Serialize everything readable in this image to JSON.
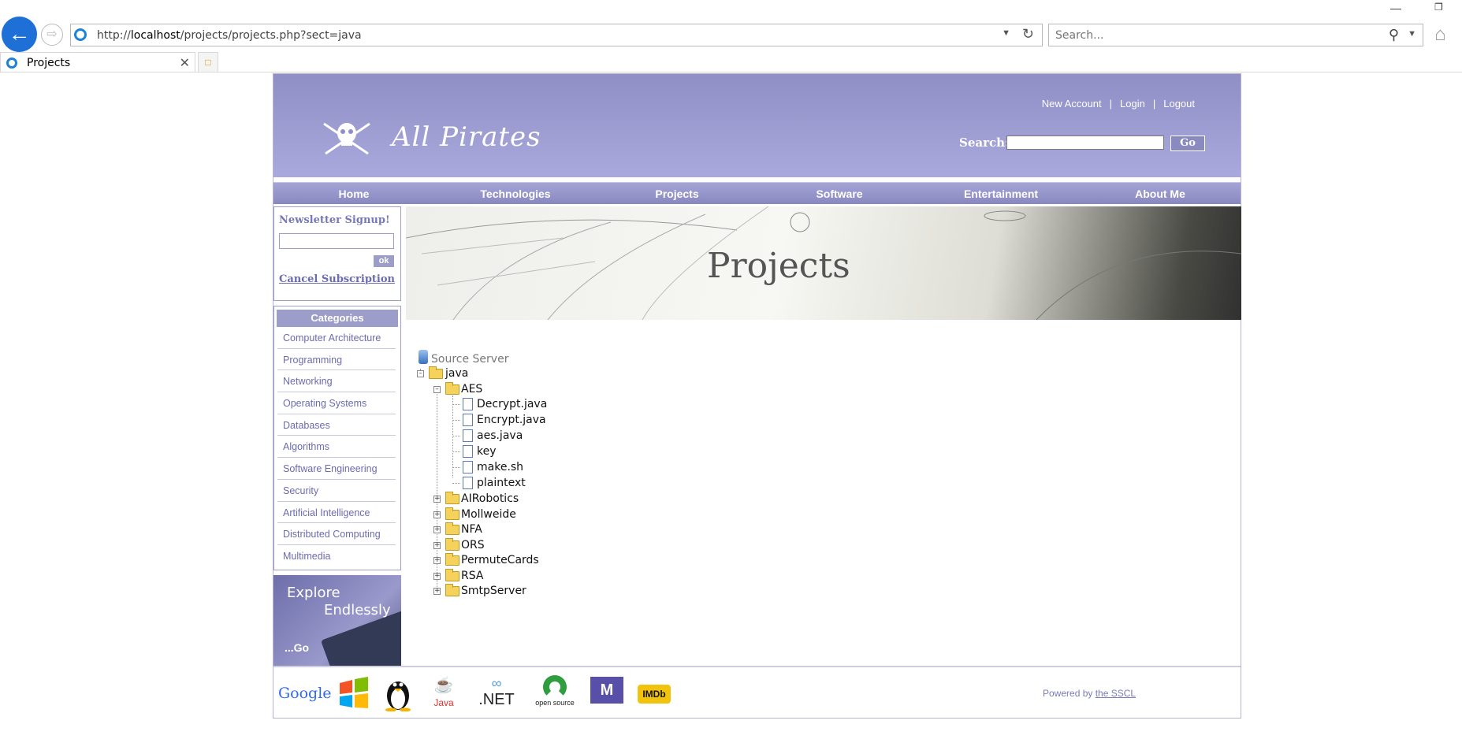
{
  "browser": {
    "url_prefix": "http://",
    "url_host": "localhost",
    "url_path": "/projects/projects.php?sect=java",
    "search_placeholder": "Search...",
    "tab_title": "Projects"
  },
  "header": {
    "site_name": "All Pirates",
    "account_links": [
      "New Account",
      "Login",
      "Logout"
    ],
    "search_label": "Search:",
    "go_label": "Go"
  },
  "menu": [
    "Home",
    "Technologies",
    "Projects",
    "Software",
    "Entertainment",
    "About Me"
  ],
  "newsletter": {
    "title": "Newsletter Signup!",
    "ok_label": "ok",
    "cancel_label": "Cancel Subscription"
  },
  "categories": {
    "title": "Categories",
    "items": [
      "Computer Architecture",
      "Programming",
      "Networking",
      "Operating Systems",
      "Databases",
      "Algorithms",
      "Software Engineering",
      "Security",
      "Artificial Intelligence",
      "Distributed Computing",
      "Multimedia"
    ]
  },
  "explore": {
    "line1": "Explore",
    "line2": "Endlessly",
    "go": "...Go"
  },
  "banner_title": "Projects",
  "tree": {
    "root_label": "Source Server",
    "java": "java",
    "aes": "AES",
    "aes_files": [
      "Decrypt.java",
      "Encrypt.java",
      "aes.java",
      "key",
      "make.sh",
      "plaintext"
    ],
    "folders": [
      "AIRobotics",
      "Mollweide",
      "NFA",
      "ORS",
      "PermuteCards",
      "RSA",
      "SmtpServer"
    ]
  },
  "footer": {
    "logos": [
      "Google",
      "Java",
      ".NET",
      "open source",
      "IMDb"
    ],
    "powered_prefix": "Powered by",
    "powered_link": "the SSCL"
  }
}
